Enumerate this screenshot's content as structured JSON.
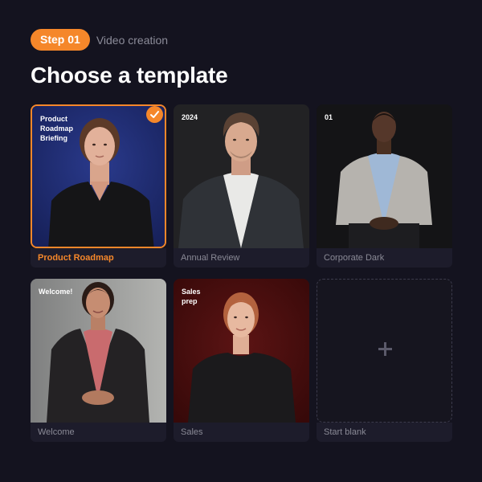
{
  "header": {
    "step_label": "Step 01",
    "step_caption": "Video creation",
    "title": "Choose a template"
  },
  "templates": [
    {
      "label": "Product Roadmap",
      "overlay_text": "Product\nRoadmap\nBriefing",
      "selected": true,
      "background": "#1d2a6e"
    },
    {
      "label": "Annual Review",
      "overlay_text": "2024",
      "selected": false,
      "background": "#232325"
    },
    {
      "label": "Corporate Dark",
      "overlay_text": "01",
      "selected": false,
      "background": "#141416"
    },
    {
      "label": "Welcome",
      "overlay_text": "Welcome!",
      "selected": false,
      "background": "#a7a8a5"
    },
    {
      "label": "Sales",
      "overlay_text": "Sales\nprep",
      "selected": false,
      "background": "#4a0f0f"
    },
    {
      "label": "Start blank",
      "overlay_text": "",
      "selected": false,
      "icon": "plus-icon"
    }
  ],
  "colors": {
    "accent": "#f5872a",
    "page_background": "#14131f",
    "label_text": "#8a8a96"
  }
}
